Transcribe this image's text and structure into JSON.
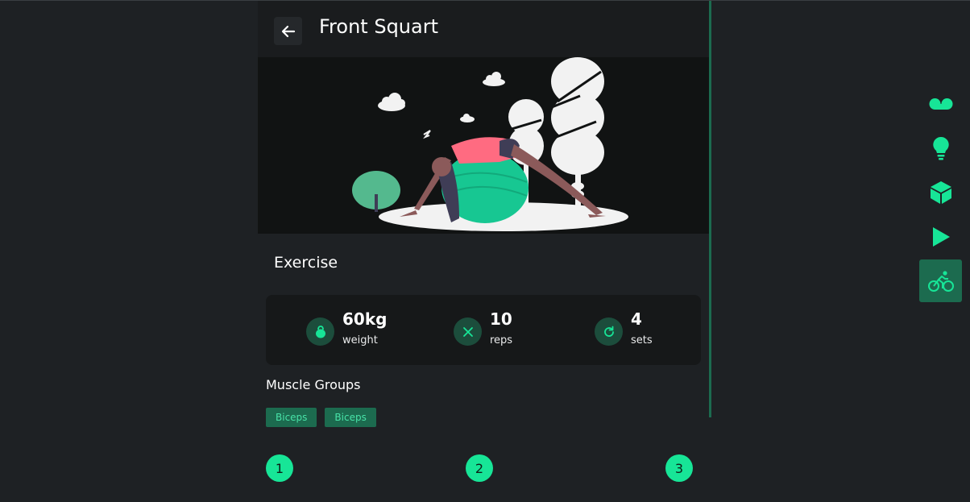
{
  "header": {
    "title": "Front Squart"
  },
  "exercise": {
    "section_title": "Exercise"
  },
  "stats": [
    {
      "value": "60kg",
      "unit": "weight",
      "icon": "kettlebell-icon"
    },
    {
      "value": "10",
      "unit": "reps",
      "icon": "close-x-icon"
    },
    {
      "value": "4",
      "unit": "sets",
      "icon": "refresh-icon"
    }
  ],
  "muscles": {
    "title": "Muscle Groups",
    "tags": [
      "Biceps",
      "Biceps"
    ]
  },
  "steps": [
    "1",
    "2",
    "3"
  ],
  "sidebar": {
    "items": [
      {
        "icon": "voicemail-icon",
        "active": false
      },
      {
        "icon": "lightbulb-icon",
        "active": false
      },
      {
        "icon": "cube-icon",
        "active": false
      },
      {
        "icon": "play-icon",
        "active": false
      },
      {
        "icon": "cyclist-icon",
        "active": true
      }
    ]
  },
  "colors": {
    "accent": "#17e597",
    "accent_dark": "#1c6b4f",
    "background": "#1e2124",
    "header": "#1a1c1e",
    "card": "#161819"
  }
}
